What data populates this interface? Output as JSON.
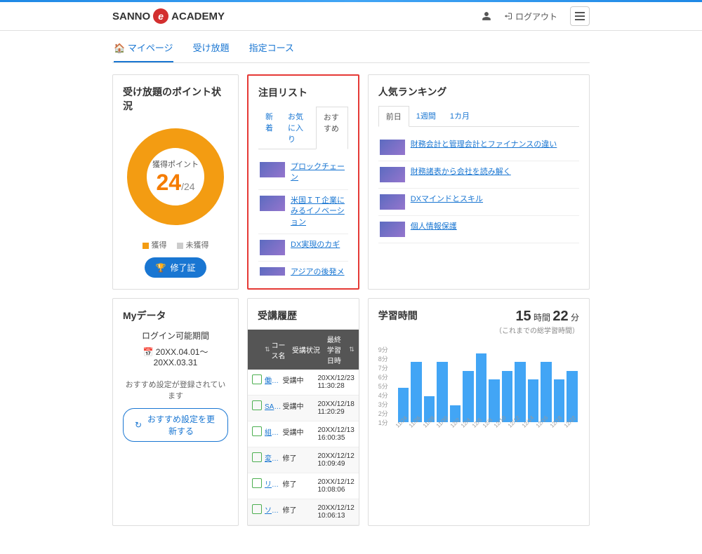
{
  "header": {
    "brand_pre": "SANNO",
    "brand_post": "ACADEMY",
    "logout": "ログアウト"
  },
  "nav": {
    "mypage": "マイページ",
    "unlimited": "受け放題",
    "designated": "指定コース"
  },
  "points_card": {
    "title": "受け放題のポイント状況",
    "label": "獲得ポイント",
    "value": "24",
    "total": "/24",
    "legend_got": "獲得",
    "legend_not": "未獲得",
    "cert_btn": "修了証"
  },
  "featured": {
    "title": "注目リスト",
    "tabs": {
      "new": "新着",
      "fav": "お気に入り",
      "rec": "おすすめ"
    },
    "items": [
      "プロックチェーン",
      "米国ＩＴ企業にみるイノベーション",
      "DX実現のカギ",
      "アジアの後発メーカーの成長プロセスとメリット"
    ]
  },
  "ranking": {
    "title": "人気ランキング",
    "tabs": {
      "prev": "前日",
      "week": "1週間",
      "month": "1カ月"
    },
    "items": [
      "財務会計と管理会計とファイナンスの違い",
      "財務諸表から会社を読み解く",
      "DXマインドとスキル",
      "個人情報保護"
    ]
  },
  "mydata": {
    "title": "Myデータ",
    "period_label": "ログイン可能期間",
    "period": "20XX.04.01～20XX.03.31",
    "note": "おすすめ設定が登録されています",
    "btn": "おすすめ設定を更新する"
  },
  "history": {
    "title": "受講履歴",
    "cols": {
      "name": "コース名",
      "status": "受講状況",
      "date": "最終学習日時"
    },
    "rows": [
      {
        "name": "働きやすい…",
        "status": "受講中",
        "date": "20XX/12/23 11:30:28"
      },
      {
        "name": "SANNOフ…",
        "status": "受講中",
        "date": "20XX/12/18 11:20:29"
      },
      {
        "name": "組織変革プ…",
        "status": "受講中",
        "date": "20XX/12/13 16:00:35"
      },
      {
        "name": "変革型リー…",
        "status": "修了",
        "date": "20XX/12/12 10:09:49"
      },
      {
        "name": "リーダーと…",
        "status": "修了",
        "date": "20XX/12/12 10:08:06"
      },
      {
        "name": "ソニーのチ…",
        "status": "修了",
        "date": "20XX/12/12 10:06:13"
      }
    ]
  },
  "study": {
    "title": "学習時間",
    "hours": "15",
    "hours_unit": "時間",
    "mins": "22",
    "mins_unit": "分",
    "sub": "（これまでの総学習時間）"
  },
  "chart_data": {
    "type": "bar",
    "title": "学習時間",
    "ylabel": "分",
    "ylim": [
      0,
      9
    ],
    "yticks": [
      "9分",
      "8分",
      "7分",
      "6分",
      "5分",
      "4分",
      "3分",
      "2分",
      "1分"
    ],
    "categories": [
      "11/24",
      "11/26",
      "11/28",
      "11/30",
      "12/2",
      "12/4",
      "12/6",
      "12/8",
      "12/10",
      "12/12",
      "12/14",
      "12/16",
      "12/18",
      "12/22"
    ],
    "values": [
      4,
      7,
      3,
      7,
      2,
      6,
      8,
      5,
      6,
      7,
      5,
      7,
      5,
      6
    ]
  }
}
